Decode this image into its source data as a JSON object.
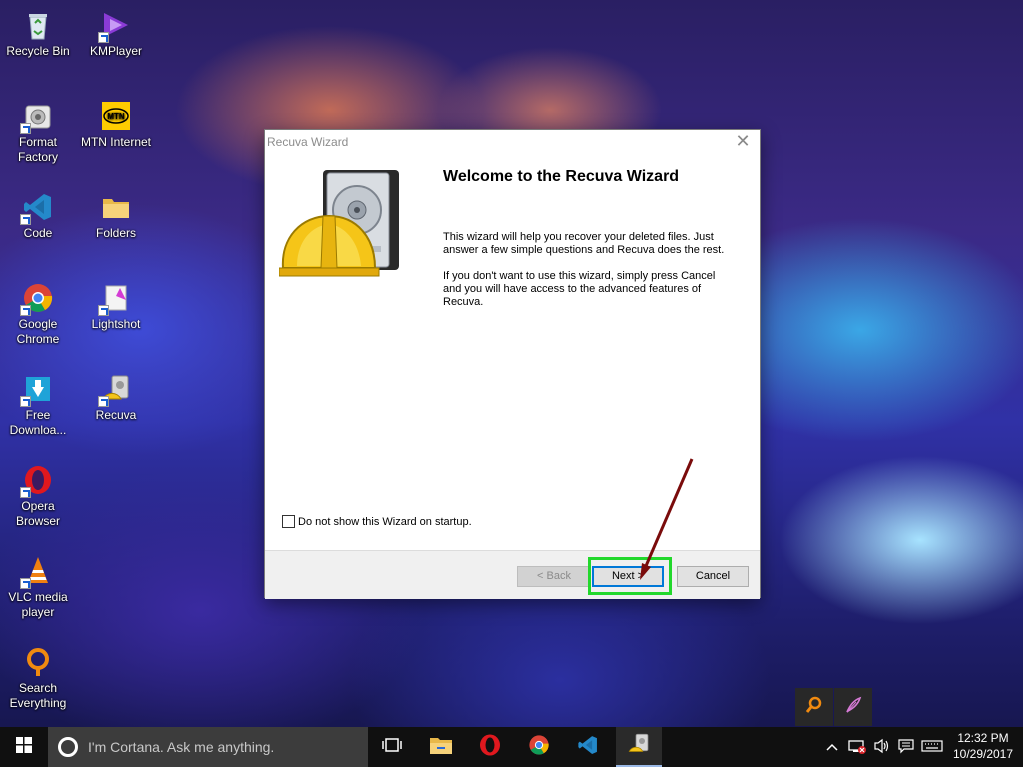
{
  "desktop": {
    "icons": [
      {
        "label": "Recycle Bin"
      },
      {
        "label": "KMPlayer"
      },
      {
        "label": "Format Factory"
      },
      {
        "label": "MTN Internet"
      },
      {
        "label": "Code"
      },
      {
        "label": "Folders"
      },
      {
        "label": "Google Chrome"
      },
      {
        "label": "Lightshot"
      },
      {
        "label": "Free Downloa..."
      },
      {
        "label": "Recuva"
      },
      {
        "label": "Opera Browser"
      },
      {
        "label": "VLC media player"
      },
      {
        "label": "Search Everything"
      }
    ]
  },
  "wizard": {
    "window_title": "Recuva Wizard",
    "heading": "Welcome to the Recuva Wizard",
    "paragraph1": "This wizard will help you recover your deleted files.  Just answer a few simple questions and Recuva does the rest.",
    "paragraph2": "If you don't want to use this wizard, simply press Cancel and you will have access to the advanced features of Recuva.",
    "startup_checkbox_label": "Do not show this Wizard on startup.",
    "startup_checkbox_checked": false,
    "back_label": "< Back",
    "next_label": "Next >",
    "cancel_label": "Cancel"
  },
  "taskbar": {
    "search_placeholder": "I'm Cortana. Ask me anything.",
    "time": "12:32 PM",
    "date": "10/29/2017"
  },
  "colors": {
    "highlight": "#22d82c",
    "arrow": "#7a0b0b",
    "taskbar": "#101010"
  }
}
